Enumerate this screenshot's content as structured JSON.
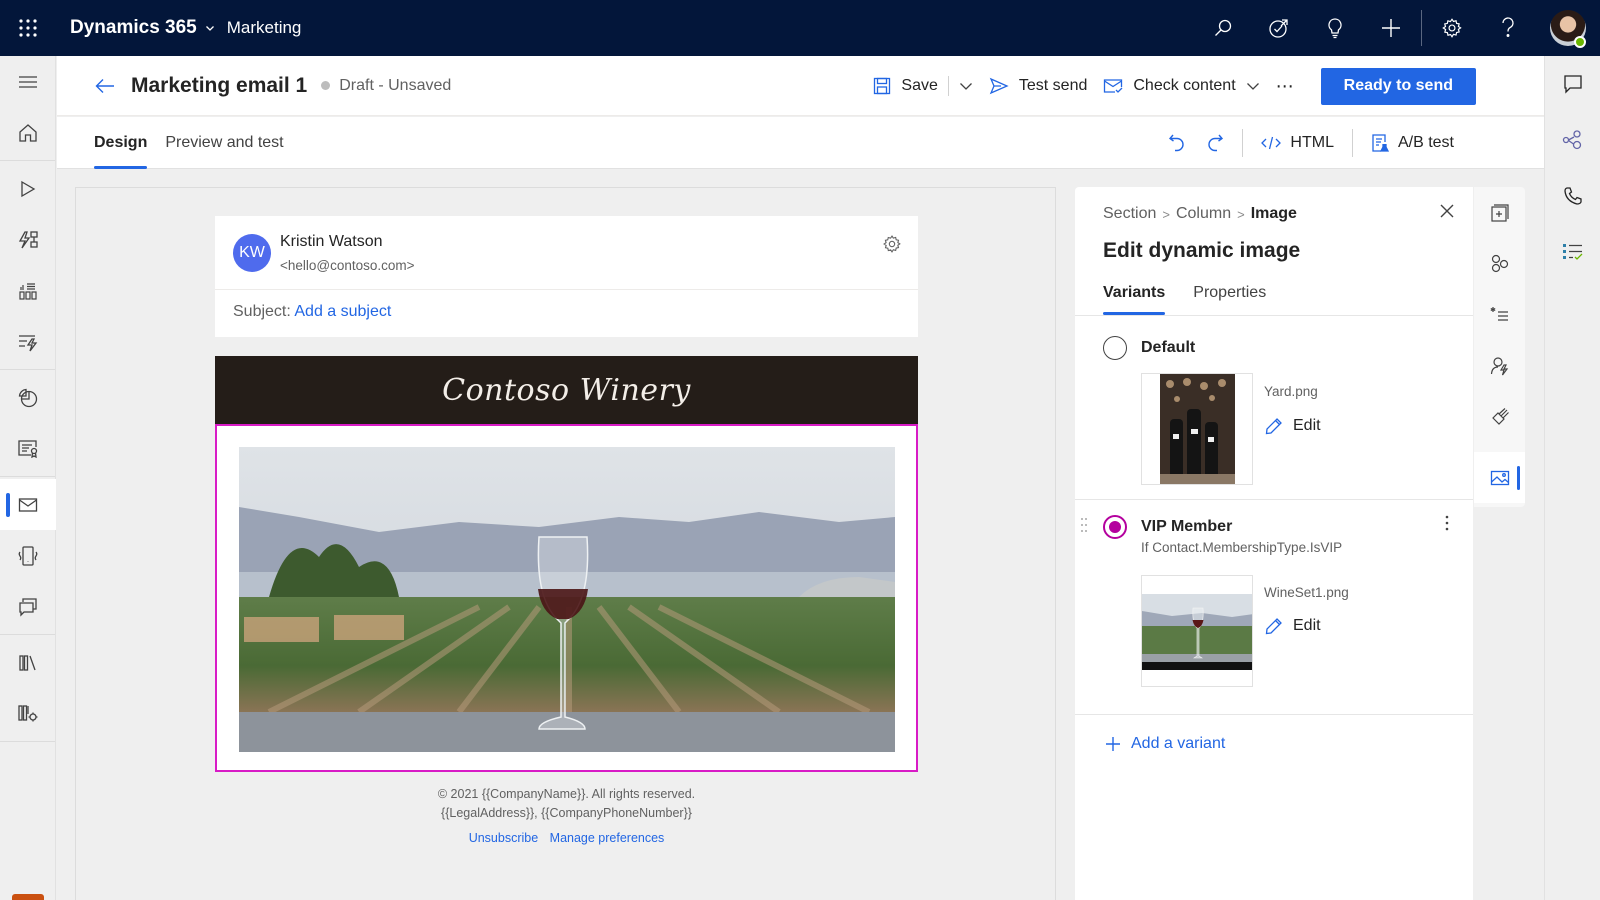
{
  "topbar": {
    "brand": "Dynamics 365",
    "app_name": "Marketing",
    "icons": [
      "search-icon",
      "task-icon",
      "lightbulb-icon",
      "add-icon",
      "settings-icon",
      "help-icon"
    ],
    "presence_color": "#6bb700"
  },
  "left_nav": {
    "items": [
      "menu-icon",
      "home-icon",
      "play-icon",
      "journey-icon",
      "segments-icon",
      "triggers-icon",
      "analytics-icon",
      "forms-icon",
      "email-icon",
      "push-icon",
      "sms-icon",
      "library-icon",
      "assets-settings-icon"
    ],
    "active": "email-icon"
  },
  "header": {
    "title": "Marketing email 1",
    "status": "Draft - Unsaved",
    "save_label": "Save",
    "test_send_label": "Test send",
    "check_content_label": "Check content",
    "more_label": "⋯",
    "primary_label": "Ready to send",
    "primary_color": "#2266e3"
  },
  "tabs": {
    "items": [
      {
        "label": "Design",
        "active": true
      },
      {
        "label": "Preview and test",
        "active": false
      }
    ],
    "html_label": "HTML",
    "ab_label": "A/B test"
  },
  "email": {
    "sender_initials": "KW",
    "sender_name": "Kristin Watson",
    "sender_email": "<hello@contoso.com>",
    "subject_label": "Subject:",
    "subject_placeholder": "Add a subject",
    "banner_text": "Contoso Winery",
    "selection_color": "#d81bc6",
    "footer_line1": "© 2021 {{CompanyName}}. All rights reserved.",
    "footer_line2": "{{LegalAddress}}, {{CompanyPhoneNumber}}",
    "unsubscribe": "Unsubscribe",
    "manage_prefs": "Manage preferences"
  },
  "pane": {
    "breadcrumb": [
      "Section",
      "Column",
      "Image"
    ],
    "title": "Edit dynamic image",
    "tabs": [
      {
        "label": "Variants",
        "active": true
      },
      {
        "label": "Properties",
        "active": false
      }
    ],
    "variants": [
      {
        "name": "Default",
        "condition": "",
        "file": "Yard.png",
        "edit_label": "Edit",
        "selected": false
      },
      {
        "name": "VIP Member",
        "condition": "If Contact.MembershipType.IsVIP",
        "file": "WineSet1.png",
        "edit_label": "Edit",
        "selected": true
      }
    ],
    "add_variant": "Add a variant"
  },
  "tool_rail": {
    "items": [
      "add-section-icon",
      "elements-icon",
      "required-fields-icon",
      "personalization-icon",
      "styles-icon",
      "image-properties-icon"
    ],
    "active": "image-properties-icon"
  },
  "far_right": {
    "items": [
      "chat-icon",
      "connections-icon",
      "phone-icon",
      "tasks-icon"
    ]
  }
}
